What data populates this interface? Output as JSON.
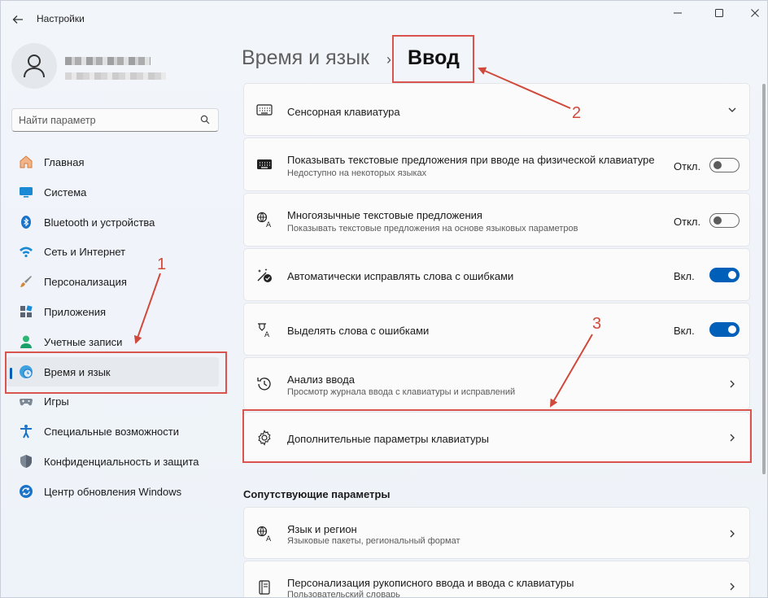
{
  "window": {
    "title": "Настройки",
    "controls": {
      "minimize": "—",
      "maximize": "☐",
      "close": "✕"
    }
  },
  "search": {
    "placeholder": "Найти параметр"
  },
  "nav": {
    "items": [
      {
        "label": "Главная",
        "icon": "home-icon"
      },
      {
        "label": "Система",
        "icon": "system-icon"
      },
      {
        "label": "Bluetooth и устройства",
        "icon": "bluetooth-icon"
      },
      {
        "label": "Сеть и Интернет",
        "icon": "wifi-icon"
      },
      {
        "label": "Персонализация",
        "icon": "brush-icon"
      },
      {
        "label": "Приложения",
        "icon": "apps-icon"
      },
      {
        "label": "Учетные записи",
        "icon": "account-icon"
      },
      {
        "label": "Время и язык",
        "icon": "time-language-icon",
        "active": true
      },
      {
        "label": "Игры",
        "icon": "gamepad-icon"
      },
      {
        "label": "Специальные возможности",
        "icon": "accessibility-icon"
      },
      {
        "label": "Конфиденциальность и защита",
        "icon": "shield-icon"
      },
      {
        "label": "Центр обновления Windows",
        "icon": "update-icon"
      }
    ]
  },
  "header": {
    "section": "Время и язык",
    "separator": "›",
    "page": "Ввод"
  },
  "cards": [
    {
      "title": "Сенсорная клавиатура",
      "icon": "touch-keyboard-icon",
      "control": "chevron-down"
    },
    {
      "title": "Показывать текстовые предложения при вводе на физической клавиатуре",
      "subtitle": "Недоступно на некоторых языках",
      "icon": "keyboard-icon",
      "state": "Откл.",
      "toggle": "off"
    },
    {
      "title": "Многоязычные текстовые предложения",
      "subtitle": "Показывать текстовые предложения на основе языковых параметров",
      "icon": "language-icon",
      "state": "Откл.",
      "toggle": "off"
    },
    {
      "title": "Автоматически исправлять слова с ошибками",
      "icon": "autocorrect-icon",
      "state": "Вкл.",
      "toggle": "on"
    },
    {
      "title": "Выделять слова с ошибками",
      "icon": "highlight-icon",
      "state": "Вкл.",
      "toggle": "on"
    },
    {
      "title": "Анализ ввода",
      "subtitle": "Просмотр журнала ввода с клавиатуры и исправлений",
      "icon": "history-icon",
      "control": "chevron-right"
    },
    {
      "title": "Дополнительные параметры клавиатуры",
      "icon": "gear-icon",
      "control": "chevron-right"
    }
  ],
  "related": {
    "heading": "Сопутствующие параметры",
    "cards": [
      {
        "title": "Язык и регион",
        "subtitle": "Языковые пакеты, региональный формат",
        "icon": "language-icon"
      },
      {
        "title": "Персонализация рукописного ввода и ввода с клавиатуры",
        "subtitle": "Пользовательский словарь",
        "icon": "notebook-icon"
      }
    ]
  },
  "annotations": {
    "one": "1",
    "two": "2",
    "three": "3",
    "color": "#d9534f"
  }
}
